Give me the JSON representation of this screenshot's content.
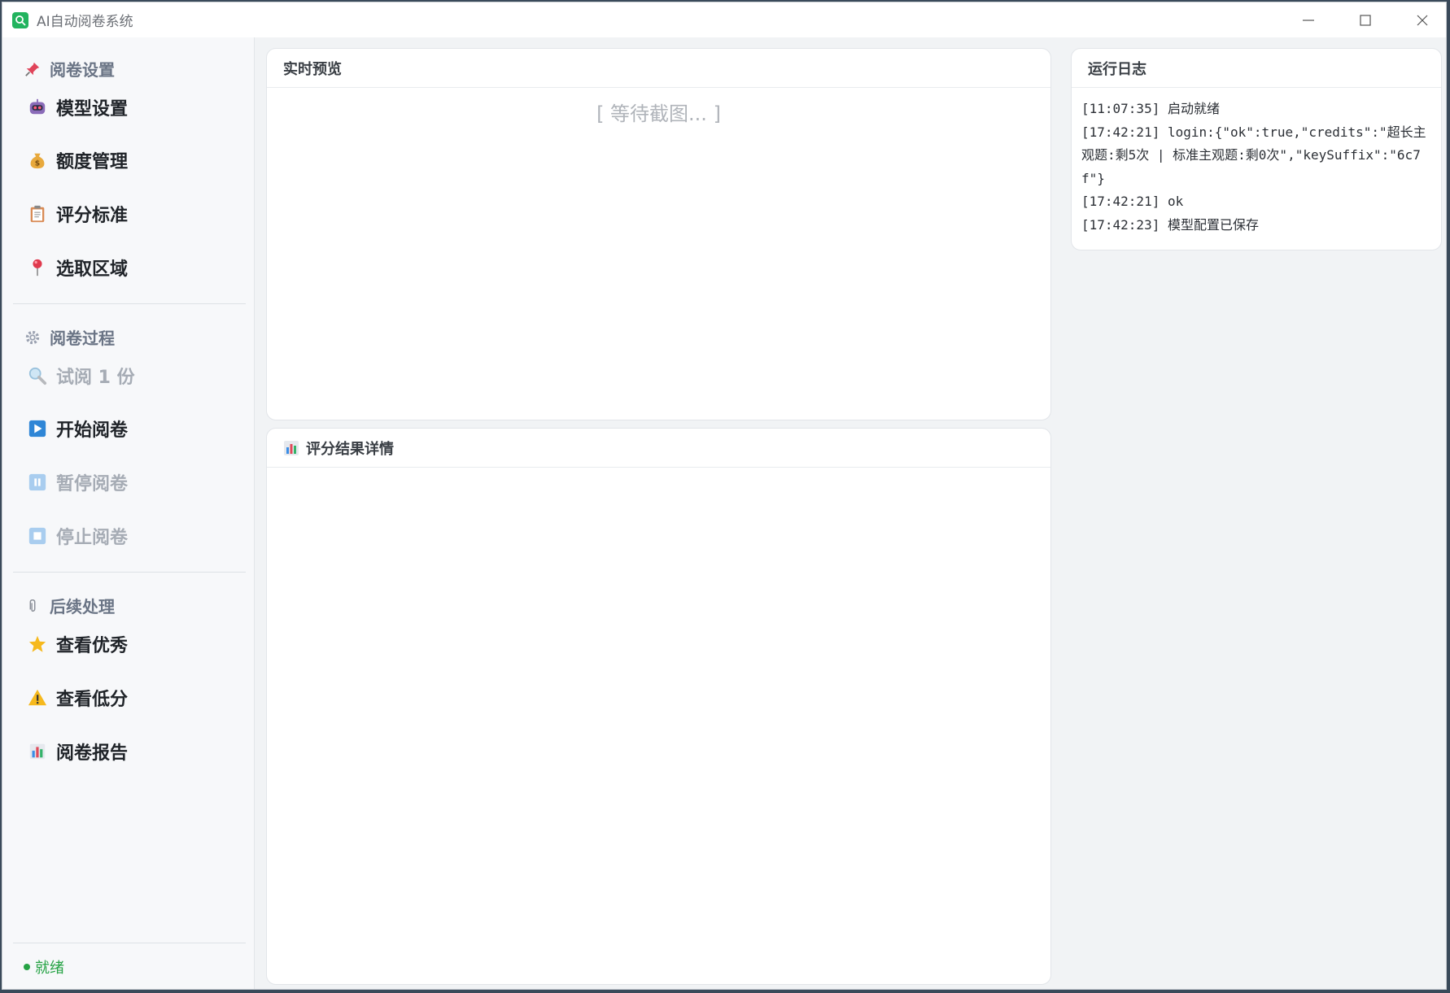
{
  "window": {
    "title": "AI自动阅卷系统"
  },
  "sidebar": {
    "sections": [
      {
        "header": "阅卷设置",
        "icon": "pushpin-icon",
        "items": [
          {
            "label": "模型设置",
            "icon": "robot-icon",
            "enabled": true
          },
          {
            "label": "额度管理",
            "icon": "money-bag-icon",
            "enabled": true
          },
          {
            "label": "评分标准",
            "icon": "clipboard-icon",
            "enabled": true
          },
          {
            "label": "选取区域",
            "icon": "map-pin-icon",
            "enabled": true
          }
        ]
      },
      {
        "header": "阅卷过程",
        "icon": "gear-icon",
        "items": [
          {
            "label": "试阅 1 份",
            "icon": "magnifier-icon",
            "enabled": false
          },
          {
            "label": "开始阅卷",
            "icon": "play-icon",
            "enabled": true
          },
          {
            "label": "暂停阅卷",
            "icon": "pause-icon",
            "enabled": false
          },
          {
            "label": "停止阅卷",
            "icon": "stop-icon",
            "enabled": false
          }
        ]
      },
      {
        "header": "后续处理",
        "icon": "paperclip-icon",
        "items": [
          {
            "label": "查看优秀",
            "icon": "star-icon",
            "enabled": true
          },
          {
            "label": "查看低分",
            "icon": "warning-icon",
            "enabled": true
          },
          {
            "label": "阅卷报告",
            "icon": "bar-chart-icon",
            "enabled": true
          }
        ]
      }
    ],
    "status": "就绪"
  },
  "preview": {
    "title": "实时预览",
    "placeholder": "[ 等待截图... ]"
  },
  "results": {
    "title": "评分结果详情",
    "icon": "bar-chart-icon"
  },
  "log": {
    "title": "运行日志",
    "entries": [
      "[11:07:35] 启动就绪",
      "[17:42:21] login:{\"ok\":true,\"credits\":\"超长主观题:剩5次 | 标准主观题:剩0次\",\"keySuffix\":\"6c7f\"}",
      "[17:42:21] ok",
      "[17:42:23] 模型配置已保存"
    ]
  },
  "colors": {
    "accent_green": "#22b35e",
    "status_green": "#25a244",
    "disabled_text": "#a6acb5"
  }
}
